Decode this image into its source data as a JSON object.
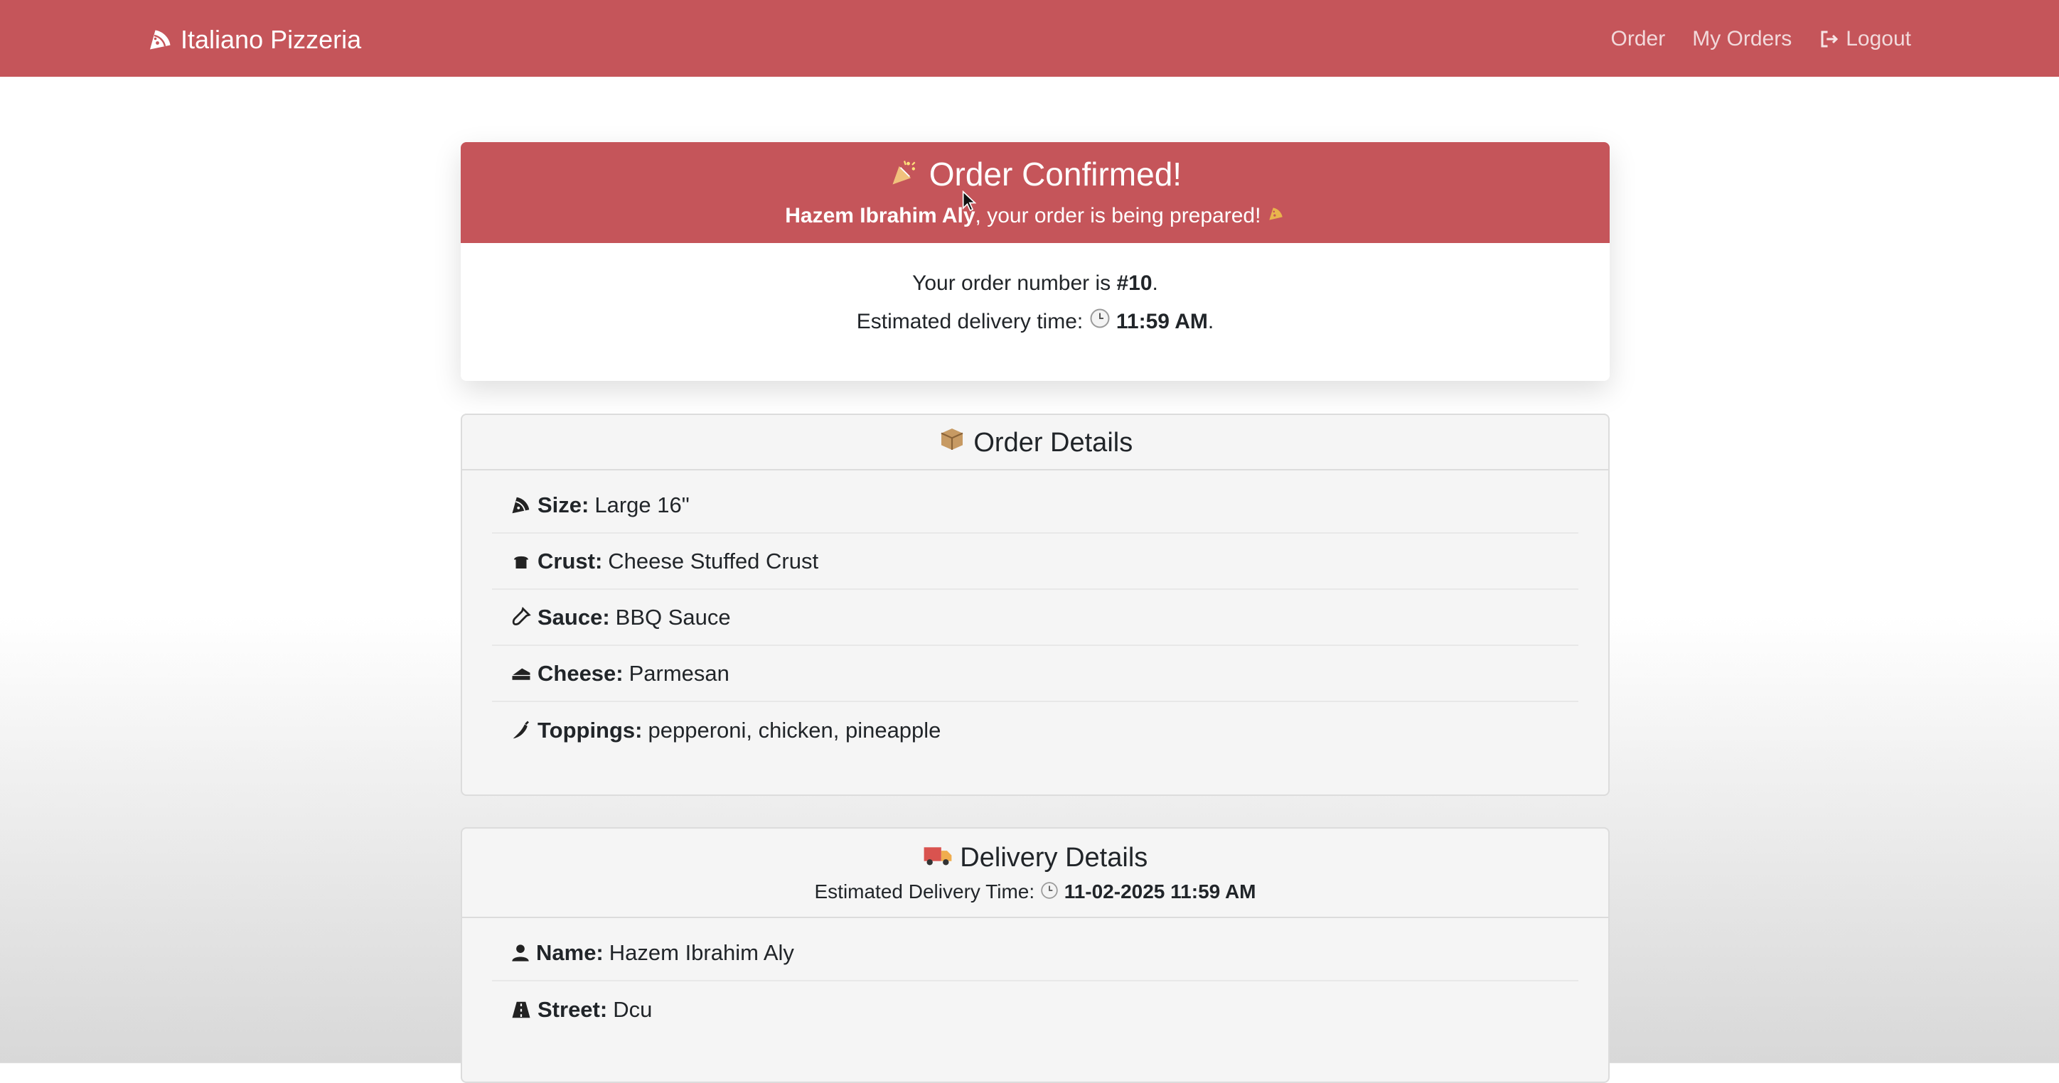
{
  "navbar": {
    "brand_icon": "pizza-slice-icon",
    "brand": "Italiano Pizzeria",
    "links": {
      "order": "Order",
      "my_orders": "My Orders",
      "logout": "Logout"
    },
    "logout_icon": "logout-icon",
    "background_color": "#c5555a"
  },
  "confirmation": {
    "title_icon": "party-popper-icon",
    "title": "Order Confirmed!",
    "customer": "Hazem Ibrahim Aly",
    "subtitle_rest": ", your order is being prepared!",
    "subtitle_icon": "pizza-icon",
    "order_number_prefix": "Your order number is ",
    "order_number": "#10",
    "delivery_prefix": "Estimated delivery time: ",
    "delivery_icon": "clock-icon",
    "delivery_time": "11:59 AM",
    "period": "."
  },
  "order_details": {
    "title_icon": "package-icon",
    "title": "Order Details",
    "rows": [
      {
        "icon": "pizza-slice-icon",
        "label": "Size:",
        "value": "Large 16\""
      },
      {
        "icon": "bread-icon",
        "label": "Crust:",
        "value": "Cheese Stuffed Crust"
      },
      {
        "icon": "sauce-bottle-icon",
        "label": "Sauce:",
        "value": "BBQ Sauce"
      },
      {
        "icon": "cheese-icon",
        "label": "Cheese:",
        "value": "Parmesan"
      },
      {
        "icon": "pepper-icon",
        "label": "Toppings:",
        "value": "pepperoni, chicken, pineapple"
      }
    ]
  },
  "delivery_details": {
    "title_icon": "delivery-truck-icon",
    "title": "Delivery Details",
    "estimated_label": "Estimated Delivery Time: ",
    "estimated_icon": "clock-icon",
    "estimated_value": "11-02-2025 11:59 AM",
    "rows": [
      {
        "icon": "user-icon",
        "label": "Name:",
        "value": "Hazem Ibrahim Aly"
      },
      {
        "icon": "road-icon",
        "label": "Street:",
        "value": "Dcu"
      }
    ]
  }
}
